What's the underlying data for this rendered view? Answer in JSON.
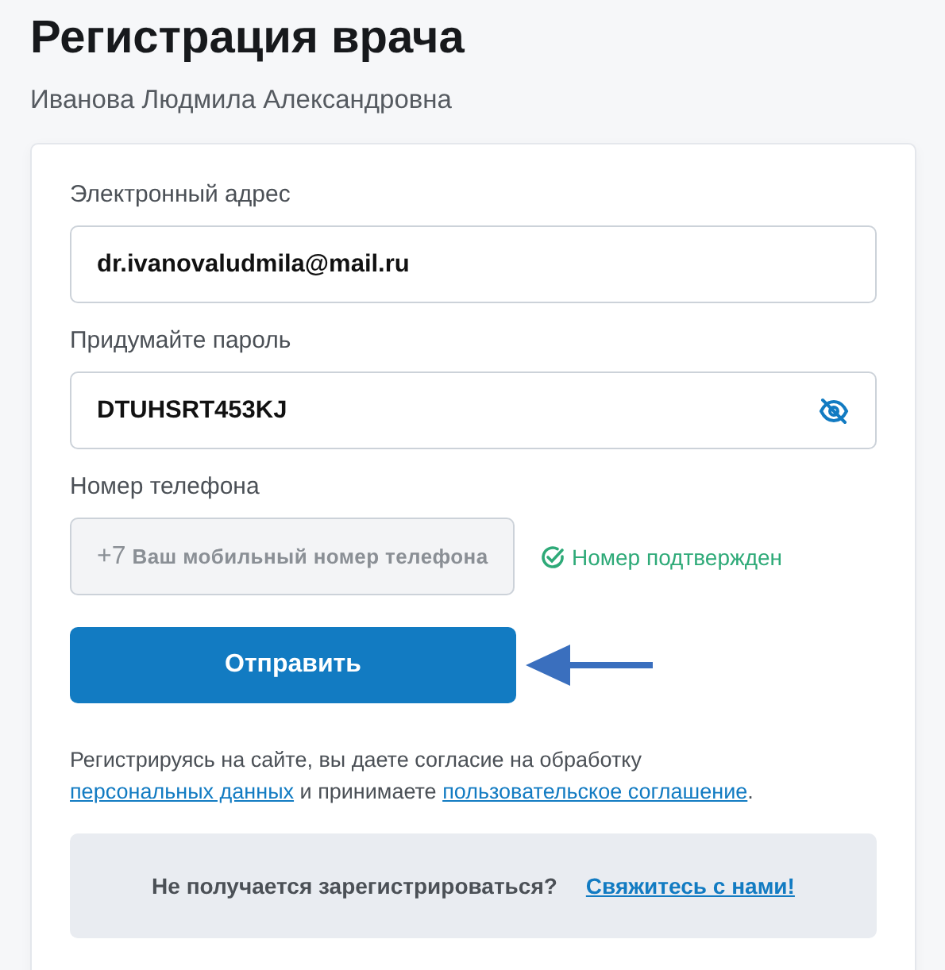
{
  "title": "Регистрация врача",
  "subtitle": "Иванова Людмила Александровна",
  "fields": [
    {
      "kind": "text",
      "label": "Электронный адрес",
      "value": "dr.ivanovaludmila@mail.ru"
    },
    {
      "kind": "password",
      "label": "Придумайте пароль",
      "value": "DTUHSRT453KJ"
    },
    {
      "kind": "phone",
      "label": "Номер телефона",
      "prefix": "+7",
      "placeholder": "Ваш мобильный номер телефона",
      "disabled": true,
      "status": "Номер подтвержден"
    }
  ],
  "submit": "Отправить",
  "consent": [
    {
      "kind": "text",
      "text": "Регистрируясь на сайте, вы даете согласие на обработку "
    },
    {
      "kind": "link",
      "text": "персональных данных"
    },
    {
      "kind": "text",
      "text": " и принимаете "
    },
    {
      "kind": "link",
      "text": "пользовательское соглашение"
    },
    {
      "kind": "text",
      "text": "."
    }
  ],
  "help": {
    "text": "Не получается зарегистрироваться?",
    "link": "Свяжитесь с нами!"
  }
}
